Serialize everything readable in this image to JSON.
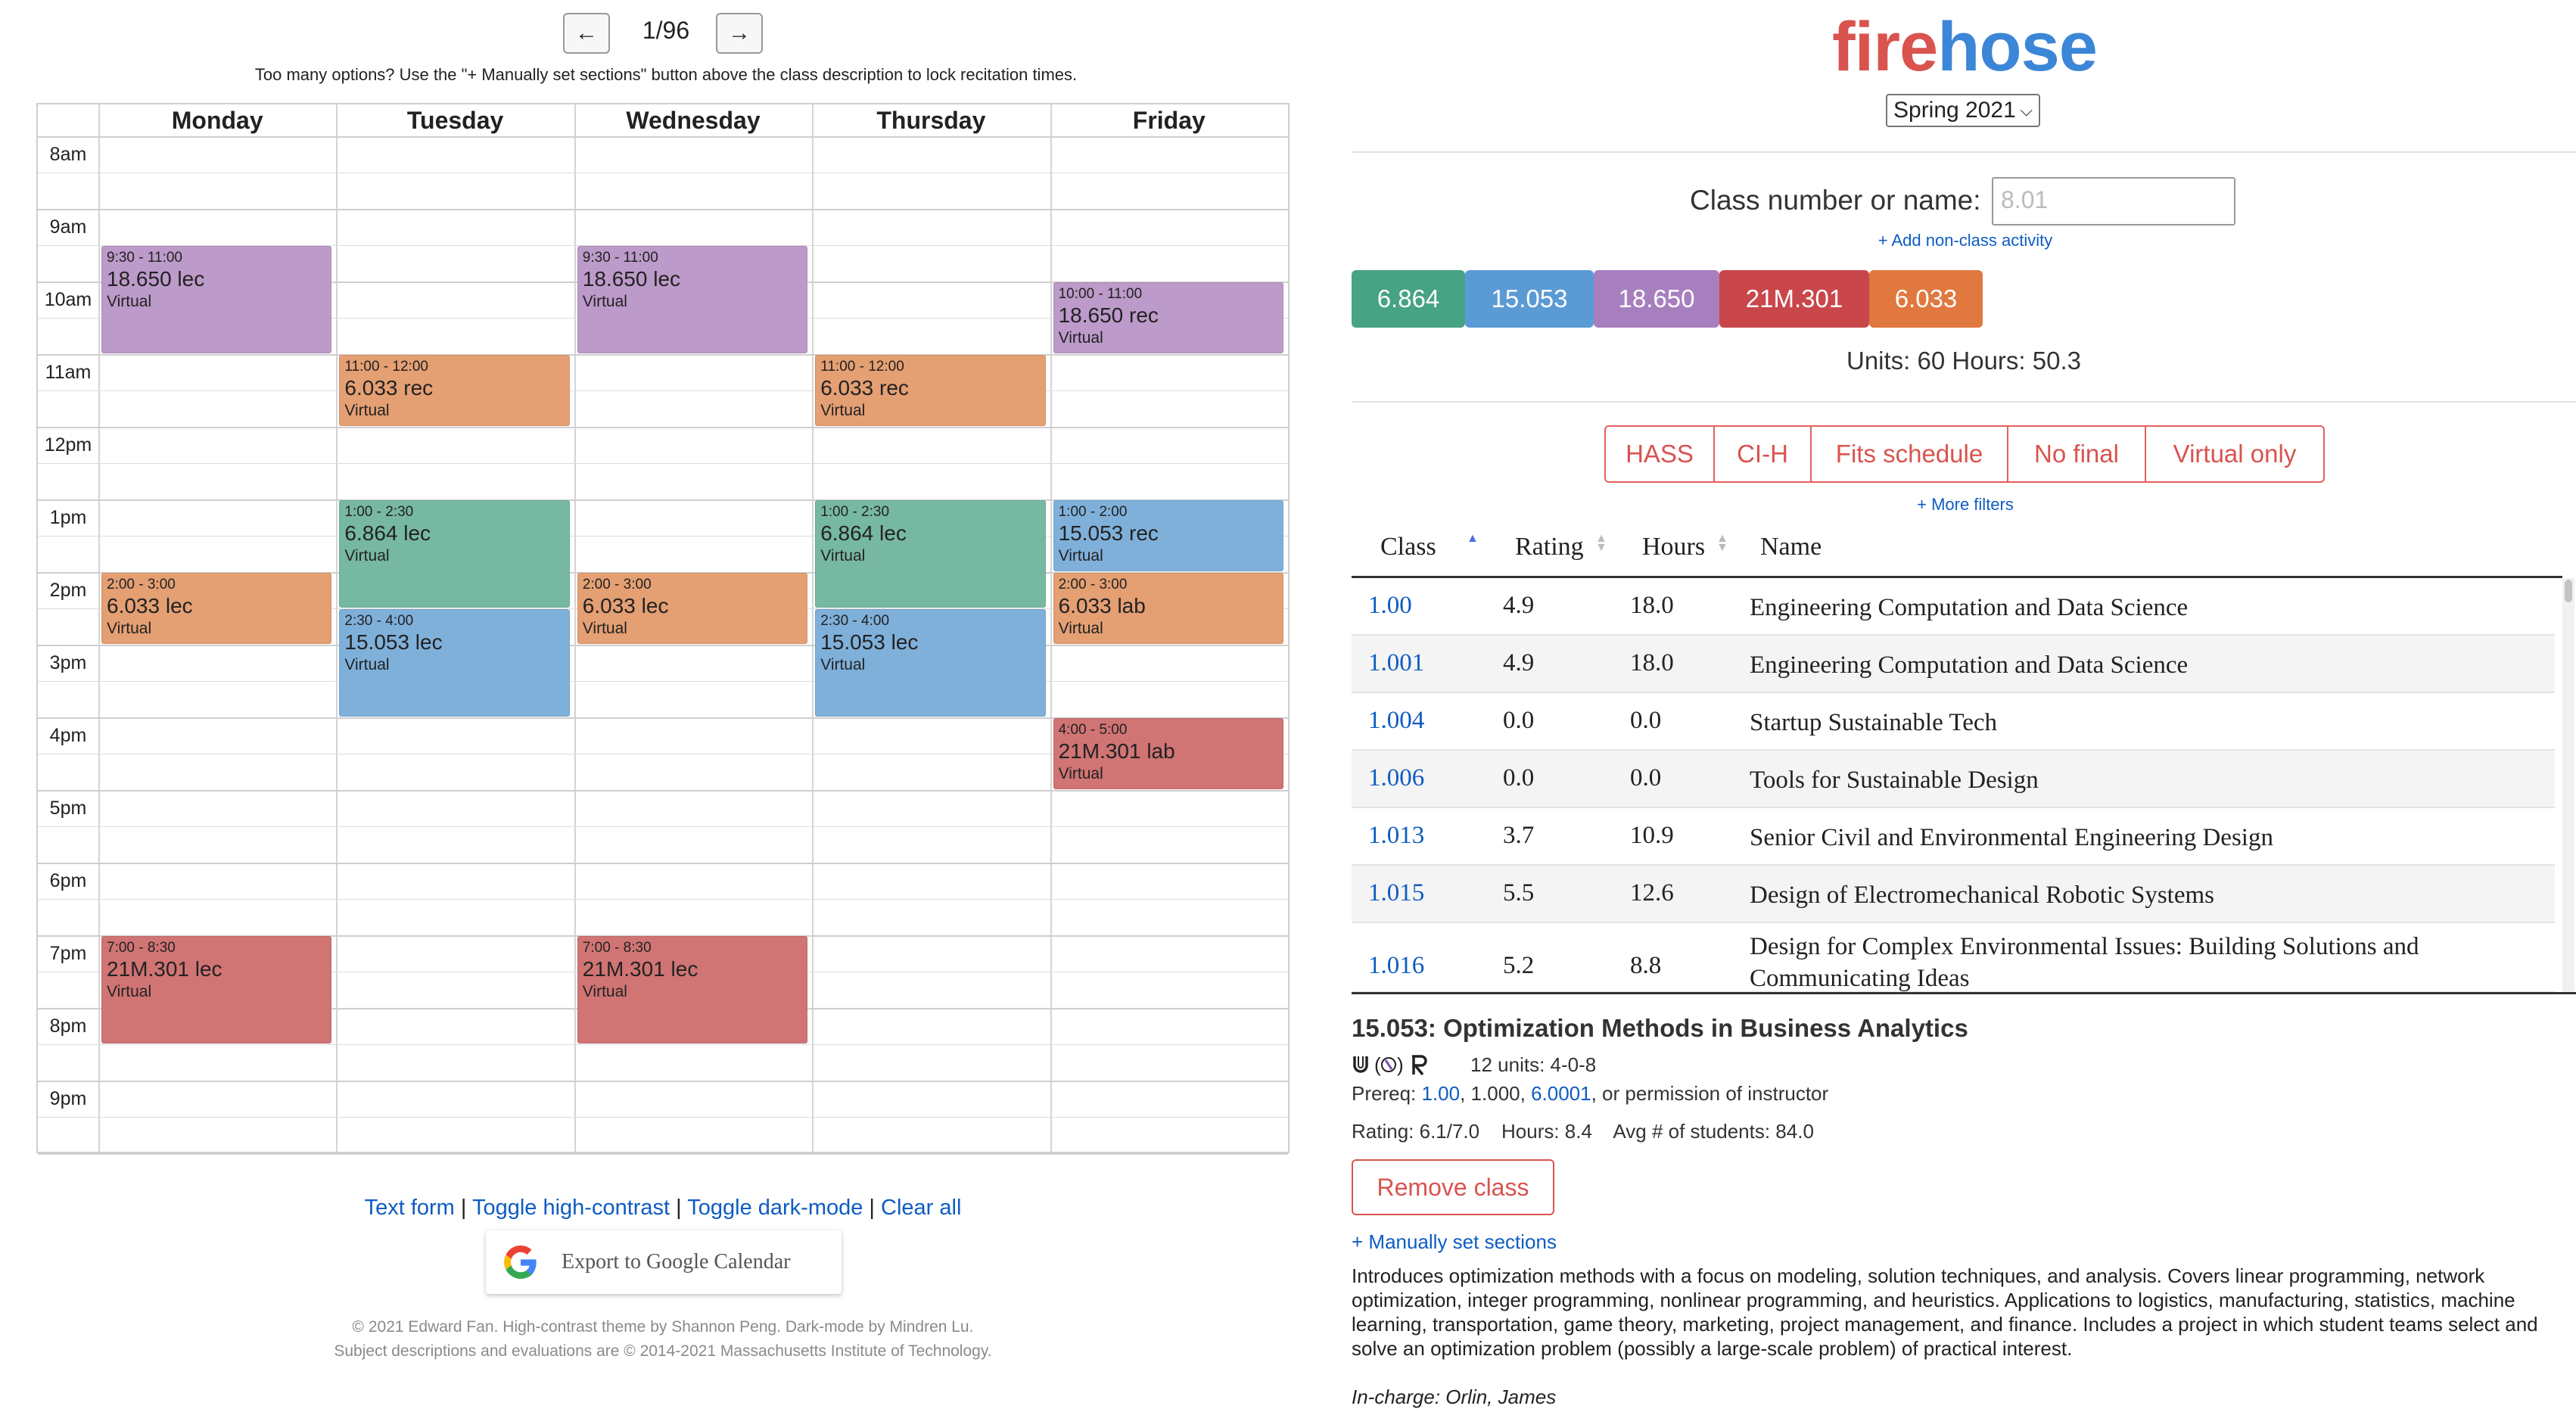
{
  "pager": {
    "prev_icon": "←",
    "next_icon": "→",
    "text": "1/96"
  },
  "hint": "Too many options? Use the \"+ Manually set sections\" button above the class description to lock recitation times.",
  "calendar": {
    "days": [
      "Monday",
      "Tuesday",
      "Wednesday",
      "Thursday",
      "Friday"
    ],
    "times": [
      "8am",
      "9am",
      "10am",
      "11am",
      "12pm",
      "1pm",
      "2pm",
      "3pm",
      "4pm",
      "5pm",
      "6pm",
      "7pm",
      "8pm",
      "9pm"
    ],
    "events": [
      {
        "day": 0,
        "start": 9.5,
        "end": 11,
        "time": "9:30 - 11:00",
        "name": "18.650 lec",
        "loc": "Virtual",
        "color": "#bc9ac9"
      },
      {
        "day": 2,
        "start": 9.5,
        "end": 11,
        "time": "9:30 - 11:00",
        "name": "18.650 lec",
        "loc": "Virtual",
        "color": "#bc9ac9"
      },
      {
        "day": 4,
        "start": 10,
        "end": 11,
        "time": "10:00 - 11:00",
        "name": "18.650 rec",
        "loc": "Virtual",
        "color": "#bc9ac9"
      },
      {
        "day": 1,
        "start": 11,
        "end": 12,
        "time": "11:00 - 12:00",
        "name": "6.033 rec",
        "loc": "Virtual",
        "color": "#e49f73"
      },
      {
        "day": 3,
        "start": 11,
        "end": 12,
        "time": "11:00 - 12:00",
        "name": "6.033 rec",
        "loc": "Virtual",
        "color": "#e49f73"
      },
      {
        "day": 1,
        "start": 13,
        "end": 14.5,
        "time": "1:00 - 2:30",
        "name": "6.864 lec",
        "loc": "Virtual",
        "color": "#77b8a2"
      },
      {
        "day": 3,
        "start": 13,
        "end": 14.5,
        "time": "1:00 - 2:30",
        "name": "6.864 lec",
        "loc": "Virtual",
        "color": "#77b8a2"
      },
      {
        "day": 4,
        "start": 13,
        "end": 14,
        "time": "1:00 - 2:00",
        "name": "15.053 rec",
        "loc": "Virtual",
        "color": "#7fb0da"
      },
      {
        "day": 0,
        "start": 14,
        "end": 15,
        "time": "2:00 - 3:00",
        "name": "6.033 lec",
        "loc": "Virtual",
        "color": "#e49f73"
      },
      {
        "day": 2,
        "start": 14,
        "end": 15,
        "time": "2:00 - 3:00",
        "name": "6.033 lec",
        "loc": "Virtual",
        "color": "#e49f73"
      },
      {
        "day": 4,
        "start": 14,
        "end": 15,
        "time": "2:00 - 3:00",
        "name": "6.033 lab",
        "loc": "Virtual",
        "color": "#e49f73"
      },
      {
        "day": 1,
        "start": 14.5,
        "end": 16,
        "time": "2:30 - 4:00",
        "name": "15.053 lec",
        "loc": "Virtual",
        "color": "#7fb0da"
      },
      {
        "day": 3,
        "start": 14.5,
        "end": 16,
        "time": "2:30 - 4:00",
        "name": "15.053 lec",
        "loc": "Virtual",
        "color": "#7fb0da"
      },
      {
        "day": 4,
        "start": 16,
        "end": 17,
        "time": "4:00 - 5:00",
        "name": "21M.301 lab",
        "loc": "Virtual",
        "color": "#d07474"
      },
      {
        "day": 0,
        "start": 19,
        "end": 20.5,
        "time": "7:00 - 8:30",
        "name": "21M.301 lec",
        "loc": "Virtual",
        "color": "#d07474"
      },
      {
        "day": 2,
        "start": 19,
        "end": 20.5,
        "time": "7:00 - 8:30",
        "name": "21M.301 lec",
        "loc": "Virtual",
        "color": "#d07474"
      }
    ]
  },
  "footer": {
    "links": [
      "Text form",
      "Toggle high-contrast",
      "Toggle dark-mode",
      "Clear all"
    ],
    "separator": " | ",
    "export_label": "Export to Google Calendar",
    "copyright_1": "© 2021 Edward Fan. High-contrast theme by Shannon Peng. Dark-mode by Mindren Lu.",
    "copyright_2": "Subject descriptions and evaluations are © 2014-2021 Massachusetts Institute of Technology."
  },
  "logo": {
    "part1": "fire",
    "part2": "hose"
  },
  "term": {
    "selected": "Spring 2021",
    "chevron": "⌵"
  },
  "search": {
    "label": "Class number or name:",
    "placeholder": "8.01",
    "add_activity": "+ Add non-class activity"
  },
  "selected_classes": [
    {
      "label": "6.864",
      "color": "#46a383"
    },
    {
      "label": "15.053",
      "color": "#5b9bd5"
    },
    {
      "label": "18.650",
      "color": "#a77fbf"
    },
    {
      "label": "21M.301",
      "color": "#c9474b"
    },
    {
      "label": "6.033",
      "color": "#e0783f"
    }
  ],
  "totals": {
    "text": "Units: 60   Hours: 50.3"
  },
  "filters": [
    "HASS",
    "CI-H",
    "Fits schedule",
    "No final",
    "Virtual only"
  ],
  "more_filters": "+ More filters",
  "table": {
    "headers": [
      "Class",
      "Rating",
      "Hours",
      "Name"
    ],
    "rows": [
      [
        "1.00",
        "4.9",
        "18.0",
        "Engineering Computation and Data Science"
      ],
      [
        "1.001",
        "4.9",
        "18.0",
        "Engineering Computation and Data Science"
      ],
      [
        "1.004",
        "0.0",
        "0.0",
        "Startup Sustainable Tech"
      ],
      [
        "1.006",
        "0.0",
        "0.0",
        "Tools for Sustainable Design"
      ],
      [
        "1.013",
        "3.7",
        "10.9",
        "Senior Civil and Environmental Engineering Design"
      ],
      [
        "1.015",
        "5.5",
        "12.6",
        "Design of Electromechanical Robotic Systems"
      ],
      [
        "1.016",
        "5.2",
        "8.8",
        "Design for Complex Environmental Issues: Building Solutions and Communicating Ideas"
      ]
    ]
  },
  "class_detail": {
    "title": "15.053: Optimization Methods in Business Analytics",
    "icons": "Ʊ ( ) Ʀ",
    "units": "12 units: 4-0-8",
    "prereq_label": "Prereq: ",
    "prereq_1": "1.00",
    "prereq_sep1": ", 1.000, ",
    "prereq_2": "6.0001",
    "prereq_tail": ", or permission of instructor",
    "stats": "Rating: 6.1/7.0    Hours: 8.4    Avg # of students: 84.0",
    "remove_label": "Remove class",
    "manual_label": "+ Manually set sections",
    "description": "Introduces optimization methods with a focus on modeling, solution techniques, and analysis. Covers linear programming, network optimization, integer programming, nonlinear programming, and heuristics. Applications to logistics, manufacturing, statistics, machine learning, transportation, game theory, marketing, project management, and finance. Includes a project in which student teams select and solve an optimization problem (possibly a large-scale problem) of practical interest.",
    "in_charge": "In-charge: Orlin, James"
  }
}
